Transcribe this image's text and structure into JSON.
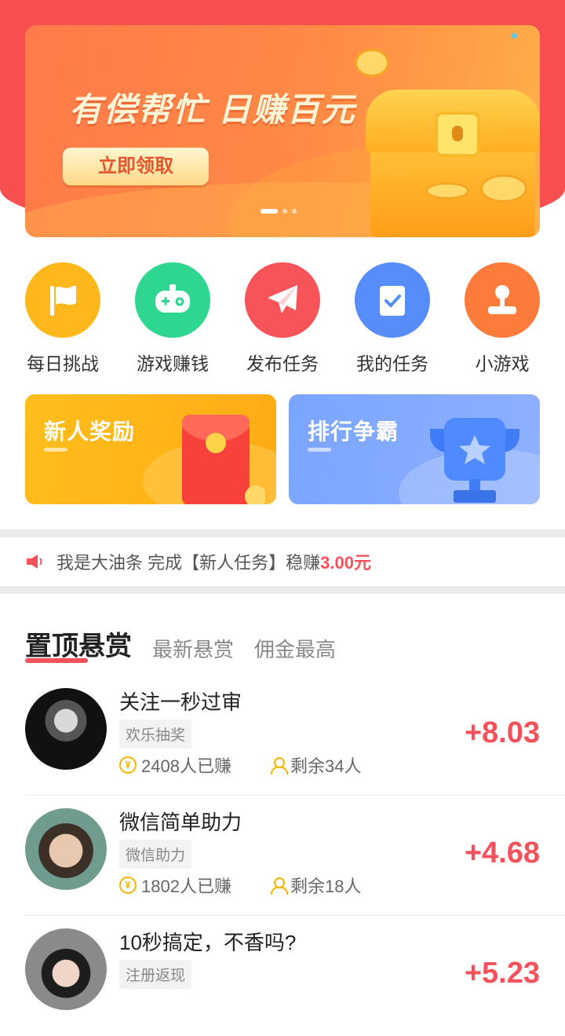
{
  "banner": {
    "title": "有偿帮忙 日赚百元",
    "button": "立即领取"
  },
  "icons": [
    {
      "label": "每日挑战",
      "icon": "flag-icon",
      "color": "#ffb81c"
    },
    {
      "label": "游戏赚钱",
      "icon": "gamepad-icon",
      "color": "#2fd690"
    },
    {
      "label": "发布任务",
      "icon": "paper-plane-icon",
      "color": "#f7545a"
    },
    {
      "label": "我的任务",
      "icon": "task-check-icon",
      "color": "#568df8"
    },
    {
      "label": "小游戏",
      "icon": "joystick-icon",
      "color": "#fd7c3c"
    }
  ],
  "cards": {
    "left": {
      "title": "新人奖励",
      "icon": "red-envelope-icon"
    },
    "right": {
      "title": "排行争霸",
      "icon": "trophy-icon"
    }
  },
  "notice": {
    "text": "我是大油条 完成【新人任务】稳赚",
    "amount": "3.00元"
  },
  "tabs": {
    "active": "置顶悬赏",
    "latest": "最新悬赏",
    "highest": "佣金最高"
  },
  "tasks": [
    {
      "title": "关注一秒过审",
      "tag": "欢乐抽奖",
      "earned": "2408人已赚",
      "remaining": "剩余34人",
      "price": "+8.03"
    },
    {
      "title": "微信简单助力",
      "tag": "微信助力",
      "earned": "1802人已赚",
      "remaining": "剩余18人",
      "price": "+4.68"
    },
    {
      "title": "10秒搞定，不香吗?",
      "tag": "注册返现",
      "earned": "",
      "remaining": "",
      "price": "+5.23"
    }
  ],
  "colors": {
    "accent": "#f4525a",
    "gold": "#f5b400"
  }
}
